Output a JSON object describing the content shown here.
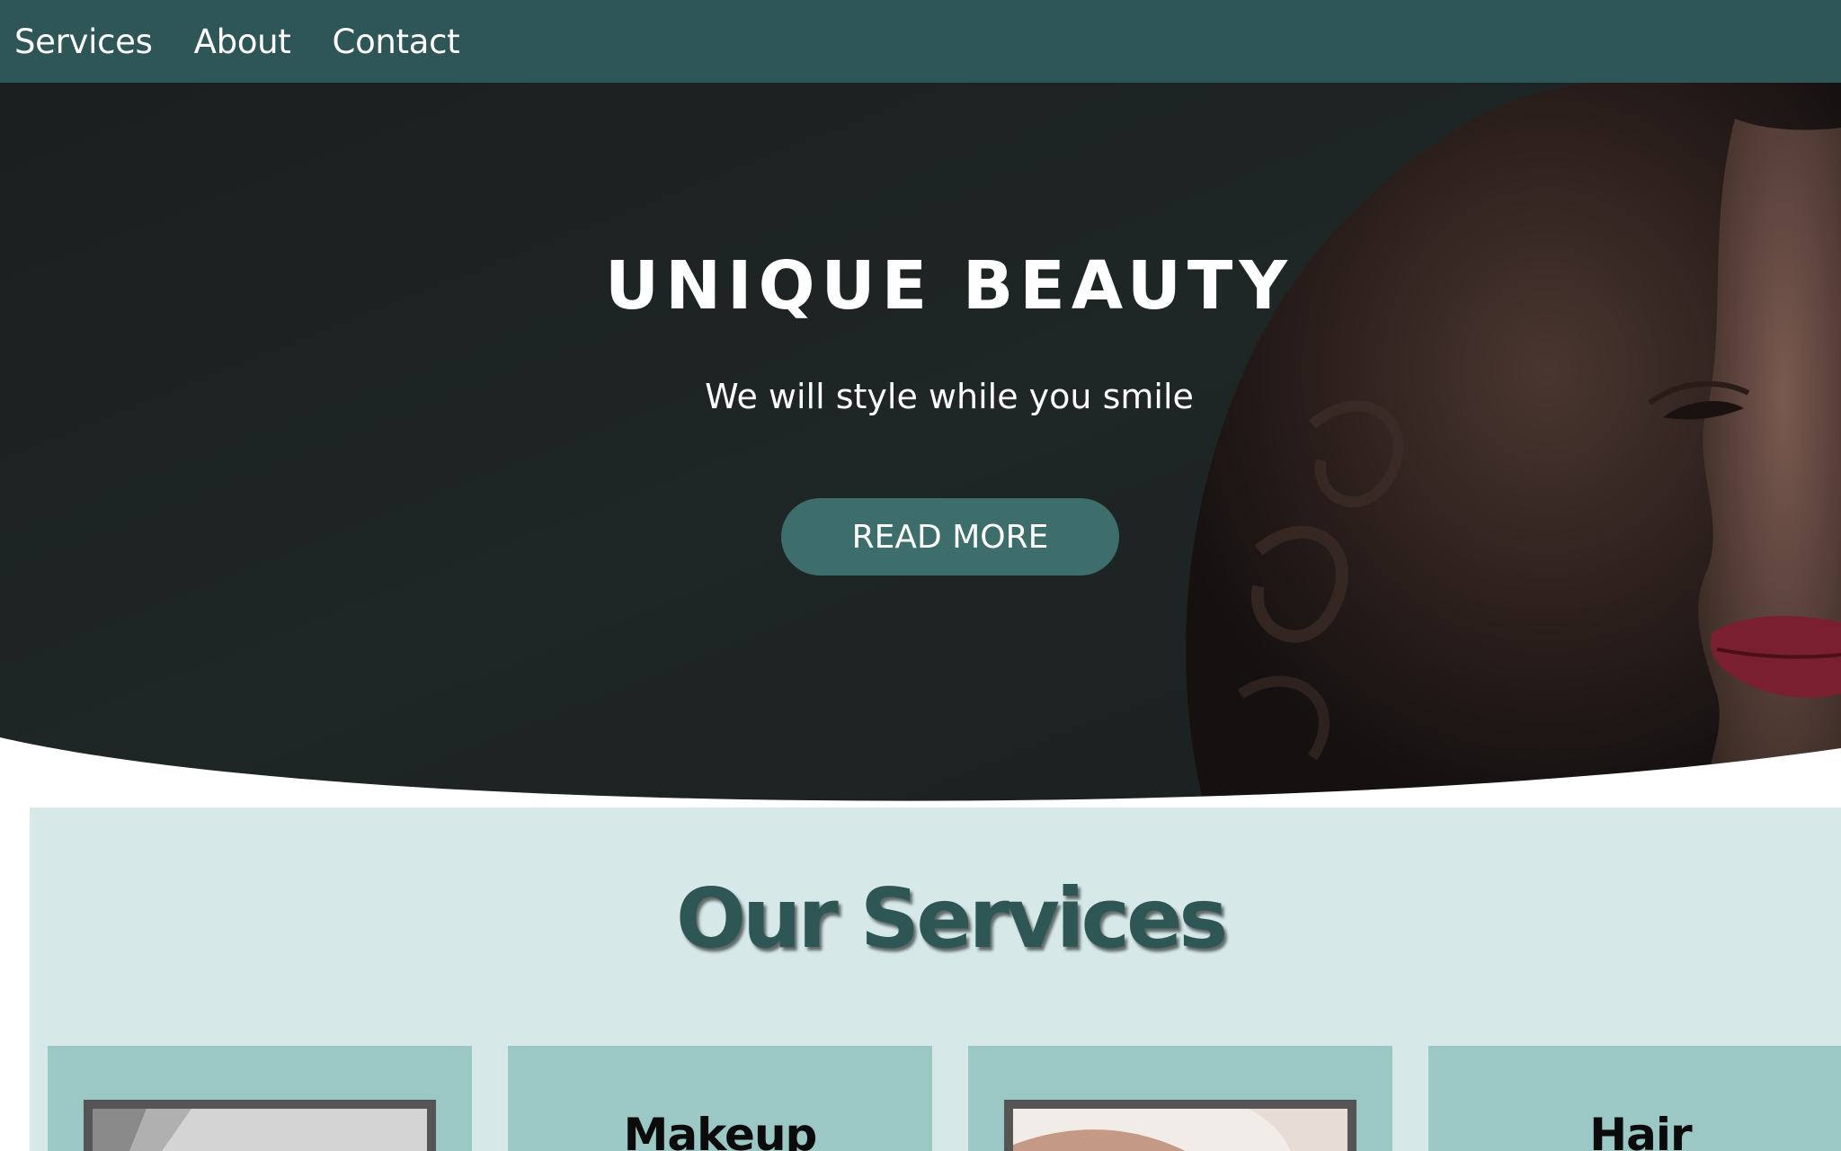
{
  "nav": {
    "items": [
      {
        "label": "Services"
      },
      {
        "label": "About"
      },
      {
        "label": "Contact"
      }
    ]
  },
  "hero": {
    "title": "UNIQUE BEAUTY",
    "subtitle": "We will style while you smile",
    "button_label": "READ MORE",
    "button_color": "#3d6e6b"
  },
  "services": {
    "heading": "Our Services",
    "cards": [
      {
        "title": ""
      },
      {
        "title": "Makeup"
      },
      {
        "title": ""
      },
      {
        "title": "Hair"
      }
    ]
  },
  "colors": {
    "nav_bg": "#2f5657",
    "services_bg": "#d6e8e8",
    "card_bg": "#9bc7c5",
    "heading": "#2e5655"
  }
}
